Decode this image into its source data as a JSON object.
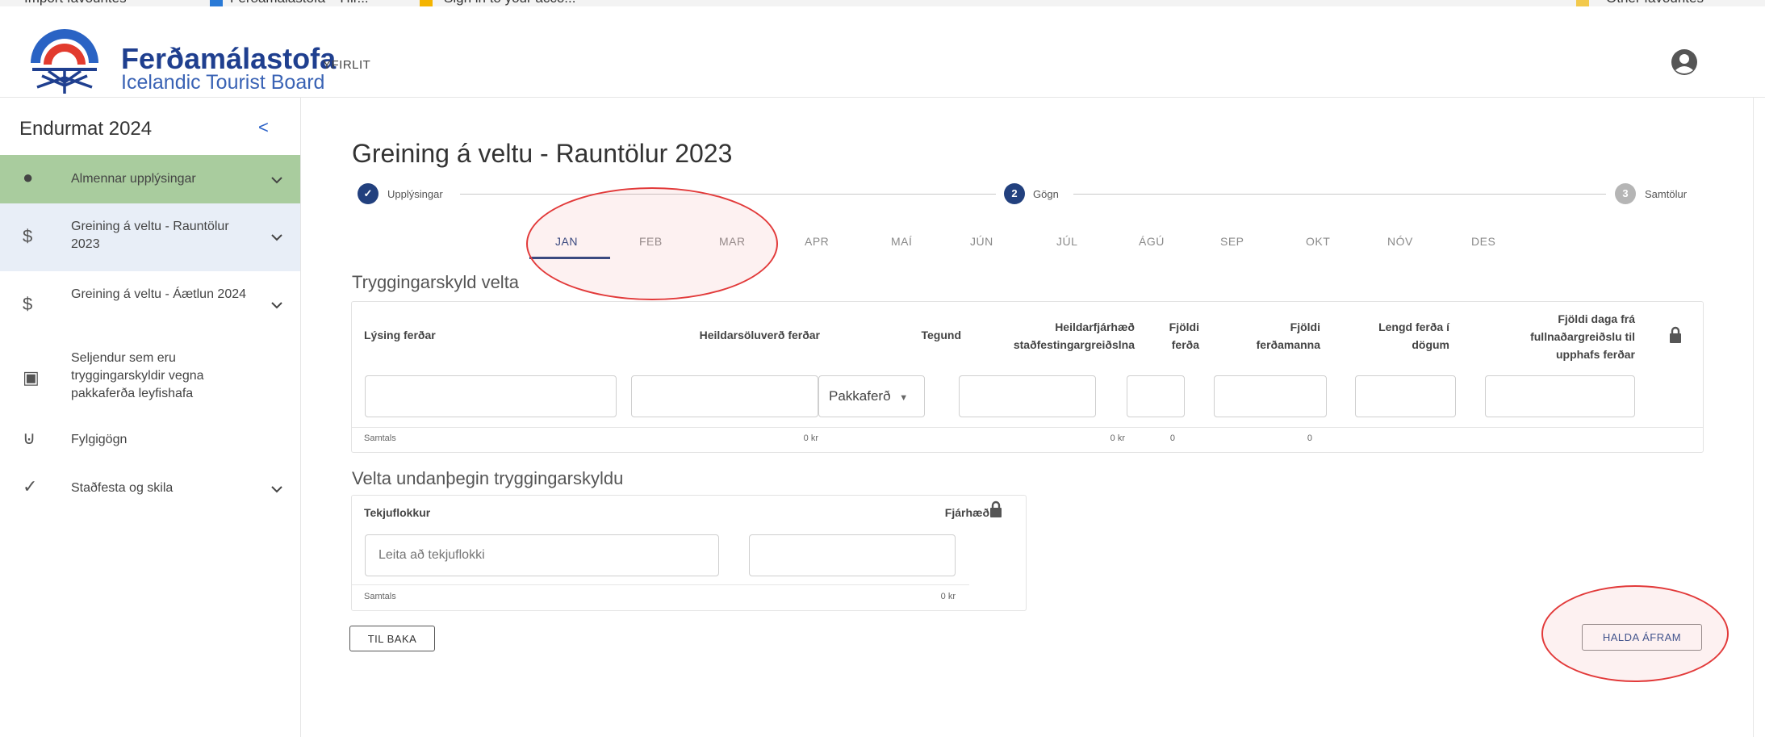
{
  "browser": {
    "fav1": "Import favourites",
    "fav2": "Ferðamálastofa - Yfir...",
    "fav3": "Sign in to your acco...",
    "fav4": "Other favourites"
  },
  "header": {
    "brand_name": "Ferðamálastofa",
    "brand_sub": "Icelandic Tourist Board",
    "nav_yfirlit": "YFIRLIT"
  },
  "sidebar": {
    "title": "Endurmat 2024",
    "collapse_symbol": "<",
    "items": [
      {
        "label": "Almennar upplýsingar",
        "icon": "info-icon",
        "icon_glyph": "●",
        "has_chevron": true
      },
      {
        "label": "Greining á veltu - Rauntölur 2023",
        "icon": "dollar-icon",
        "icon_glyph": "$",
        "has_chevron": true
      },
      {
        "label": "Greining á veltu - Áætlun 2024",
        "icon": "dollar-icon",
        "icon_glyph": "$",
        "has_chevron": true
      },
      {
        "label": "Seljendur sem eru tryggingarskyldir vegna pakkaferða leyfishafa",
        "icon": "id-card-icon",
        "icon_glyph": "▣",
        "has_chevron": false
      },
      {
        "label": "Fylgigögn",
        "icon": "paperclip-icon",
        "icon_glyph": "⊍",
        "has_chevron": false
      },
      {
        "label": "Staðfesta og skila",
        "icon": "check-icon",
        "icon_glyph": "✓",
        "has_chevron": true
      }
    ]
  },
  "main": {
    "title": "Greining á veltu - Rauntölur 2023",
    "stepper": [
      {
        "label": "Upplýsingar",
        "marker": "✓",
        "state": "done"
      },
      {
        "label": "Gögn",
        "marker": "2",
        "state": "active"
      },
      {
        "label": "Samtölur",
        "marker": "3",
        "state": "pending"
      }
    ],
    "months": [
      "JAN",
      "FEB",
      "MAR",
      "APR",
      "MAÍ",
      "JÚN",
      "JÚL",
      "ÁGÚ",
      "SEP",
      "OKT",
      "NÓV",
      "DES"
    ],
    "active_month": "JAN",
    "section1": {
      "title": "Tryggingarskyld velta",
      "headers": {
        "lysing": "Lýsing ferðar",
        "heildarsoluverd": "Heildarsöluverð ferðar",
        "tegund": "Tegund",
        "heildarfjarhaed_1": "Heildarfjárhæð",
        "heildarfjarhaed_2": "staðfestingargreiðslna",
        "fjoldi_ferda_1": "Fjöldi",
        "fjoldi_ferda_2": "ferða",
        "fjoldi_ferdamanna_1": "Fjöldi",
        "fjoldi_ferdamanna_2": "ferðamanna",
        "lengd_1": "Lengd ferða í",
        "lengd_2": "dögum",
        "fjoldi_daga_1": "Fjöldi daga frá",
        "fjoldi_daga_2": "fullnaðargreiðslu til",
        "fjoldi_daga_3": "upphafs ferðar"
      },
      "tegund_value": "Pakkaferð",
      "totals": {
        "label": "Samtals",
        "heildarsoluverd": "0 kr",
        "heildarfjarhaed": "0 kr",
        "ferda": "0",
        "ferdamanna": "0"
      }
    },
    "section2": {
      "title": "Velta undanþegin tryggingarskyldu",
      "headers": {
        "tekjuflokkur": "Tekjuflokkur",
        "fjarhaed": "Fjárhæð"
      },
      "search_placeholder": "Leita að tekjuflokki",
      "totals": {
        "label": "Samtals",
        "fjarhaed": "0 kr"
      }
    },
    "buttons": {
      "back": "TIL BAKA",
      "next": "HALDA ÁFRAM"
    }
  },
  "colors": {
    "brand_blue": "#1f3f8f",
    "active_sidebar": "#a9cc9e",
    "selected_sidebar": "#e8eef7",
    "annotation_red": "#e23a3a"
  }
}
